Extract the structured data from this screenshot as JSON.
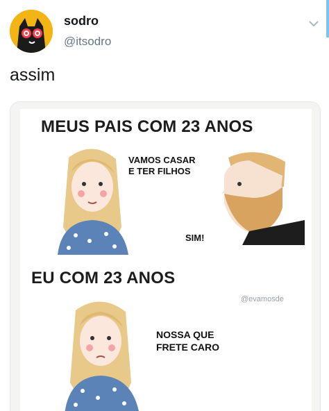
{
  "user": {
    "display_name": "sodro",
    "handle": "@itsodro"
  },
  "tweet": {
    "text": "assim"
  },
  "meme": {
    "heading_top": "MEUS PAIS COM 23 ANOS",
    "speech_woman_top": "VAMOS CASAR\nE TER FILHOS",
    "speech_man": "SIM!",
    "heading_bottom": "EU COM 23 ANOS",
    "watermark": "@evamosde",
    "speech_woman_bottom": "NOSSA QUE\nFRETE CARO"
  },
  "colors": {
    "avatar_bg": "#f3b415",
    "link_bar": "#7fc2ef",
    "handle": "#657786"
  },
  "icons": {
    "chevron": "chevron-down-icon",
    "avatar": "cat-avatar"
  }
}
